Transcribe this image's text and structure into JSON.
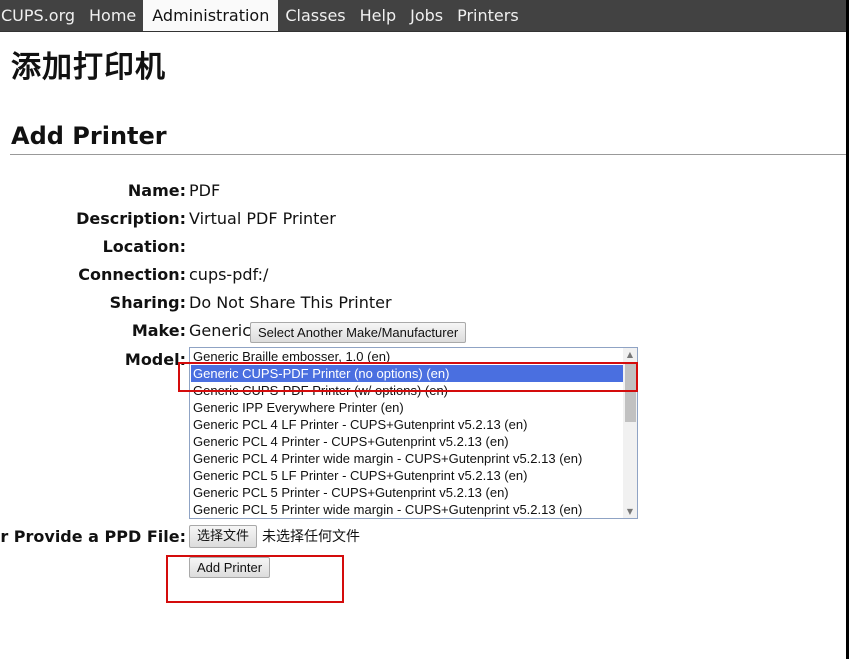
{
  "nav": {
    "items": [
      {
        "label": "CUPS.org",
        "active": false
      },
      {
        "label": "Home",
        "active": false
      },
      {
        "label": "Administration",
        "active": true
      },
      {
        "label": "Classes",
        "active": false
      },
      {
        "label": "Help",
        "active": false
      },
      {
        "label": "Jobs",
        "active": false
      },
      {
        "label": "Printers",
        "active": false
      }
    ]
  },
  "page": {
    "title": "添加打印机",
    "section_title": "Add Printer"
  },
  "form": {
    "name": {
      "label": "Name:",
      "value": "PDF"
    },
    "description": {
      "label": "Description:",
      "value": "Virtual PDF Printer"
    },
    "location": {
      "label": "Location:",
      "value": ""
    },
    "connection": {
      "label": "Connection:",
      "value": "cups-pdf:/"
    },
    "sharing": {
      "label": "Sharing:",
      "value": "Do Not Share This Printer"
    },
    "make": {
      "label": "Make:",
      "value": "Generic",
      "button_label": "Select Another Make/Manufacturer"
    },
    "model": {
      "label": "Model:",
      "selected_index": 1,
      "options": [
        "Generic Braille embosser, 1.0 (en)",
        "Generic CUPS-PDF Printer (no options) (en)",
        "Generic CUPS-PDF Printer (w/ options) (en)",
        "Generic IPP Everywhere Printer (en)",
        "Generic PCL 4 LF Printer - CUPS+Gutenprint v5.2.13 (en)",
        "Generic PCL 4 Printer - CUPS+Gutenprint v5.2.13 (en)",
        "Generic PCL 4 Printer wide margin - CUPS+Gutenprint v5.2.13 (en)",
        "Generic PCL 5 LF Printer - CUPS+Gutenprint v5.2.13 (en)",
        "Generic PCL 5 Printer - CUPS+Gutenprint v5.2.13 (en)",
        "Generic PCL 5 Printer wide margin - CUPS+Gutenprint v5.2.13 (en)"
      ]
    },
    "ppd": {
      "label": "Or Provide a PPD File:",
      "choose_button": "选择文件",
      "no_file_text": "未选择任何文件"
    },
    "submit_label": "Add Printer"
  },
  "colors": {
    "nav_bg": "#424242",
    "selected_option": "#4a6fe0",
    "annotation": "#d40c0c"
  }
}
